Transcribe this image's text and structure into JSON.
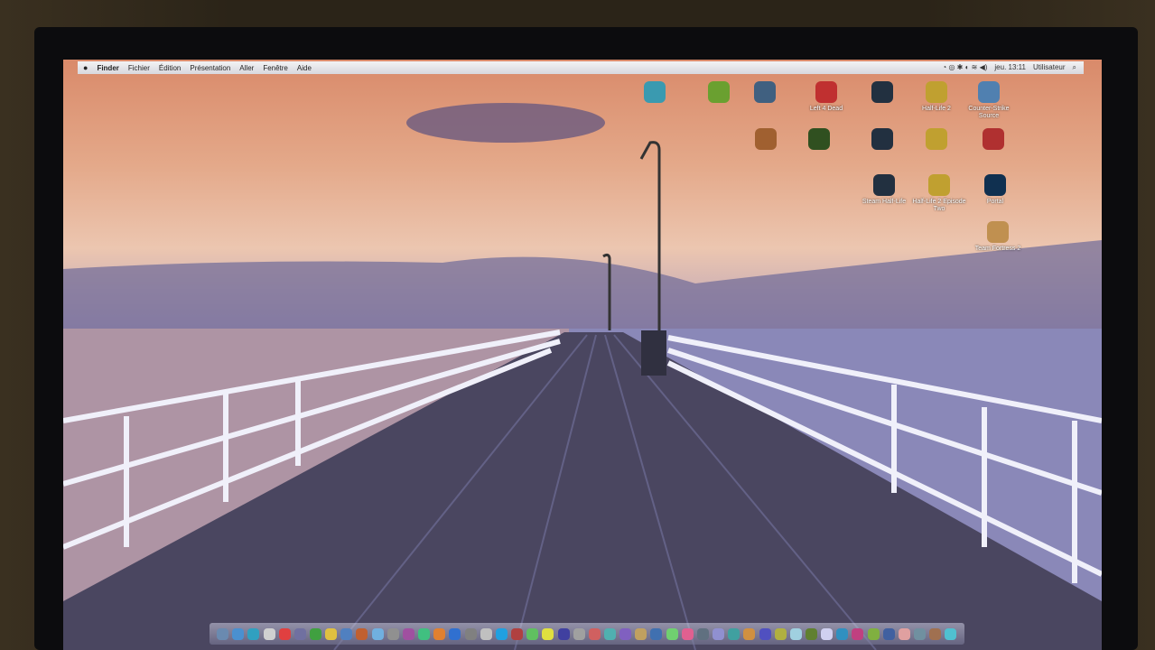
{
  "menubar": {
    "apple": "",
    "items": [
      "Finder",
      "Fichier",
      "Édition",
      "Présentation",
      "Aller",
      "Fenêtre",
      "Aide"
    ],
    "clock": "jeu. 13:11",
    "user": "Utilisateur"
  },
  "desktop_icons": [
    {
      "label": "",
      "color": "#3a9ab0"
    },
    {
      "label": "",
      "color": "#6aa030"
    },
    {
      "label": "",
      "color": "#406080"
    },
    {
      "label": "Left 4 Dead",
      "color": "#c03030"
    },
    {
      "label": "",
      "color": "#223040"
    },
    {
      "label": "Half-Life 2",
      "color": "#c0a030"
    },
    {
      "label": "Counter-Strike Source",
      "color": "#5080b0"
    },
    {
      "label": "",
      "color": "#a06030"
    },
    {
      "label": "",
      "color": "#305020"
    },
    {
      "label": "",
      "color": "#223040"
    },
    {
      "label": "",
      "color": "#c0a030"
    },
    {
      "label": "",
      "color": "#b03030"
    },
    {
      "label": "Steam Half-Life",
      "color": "#223040"
    },
    {
      "label": "Half-Life 2 Episode Two",
      "color": "#c0a030"
    },
    {
      "label": "Portal",
      "color": "#103050"
    },
    {
      "label": "Team Fortress 2",
      "color": "#c09050"
    }
  ],
  "dock_colors": [
    "#6a8ab0",
    "#4a90d0",
    "#30a0c0",
    "#d0d0d0",
    "#e04040",
    "#7070a0",
    "#40a040",
    "#e0c040",
    "#5080c0",
    "#c06030",
    "#70b0e0",
    "#909090",
    "#a050a0",
    "#40c080",
    "#e08030",
    "#3070d0",
    "#808080",
    "#c0c0c0",
    "#20a0e0",
    "#b04040",
    "#60c060",
    "#e0e040",
    "#4040a0",
    "#a0a0a0",
    "#d06060",
    "#50b0b0",
    "#8060c0",
    "#c0a060",
    "#4070b0",
    "#70d070",
    "#e06090",
    "#607080",
    "#9090d0",
    "#40a0a0",
    "#d09040",
    "#5050c0",
    "#b0b040",
    "#a0d0e0",
    "#608030",
    "#d0d0f0",
    "#3090c0",
    "#c04080",
    "#80b040",
    "#4060a0",
    "#e0a0a0",
    "#7090a0",
    "#a07050",
    "#50c0d0"
  ]
}
